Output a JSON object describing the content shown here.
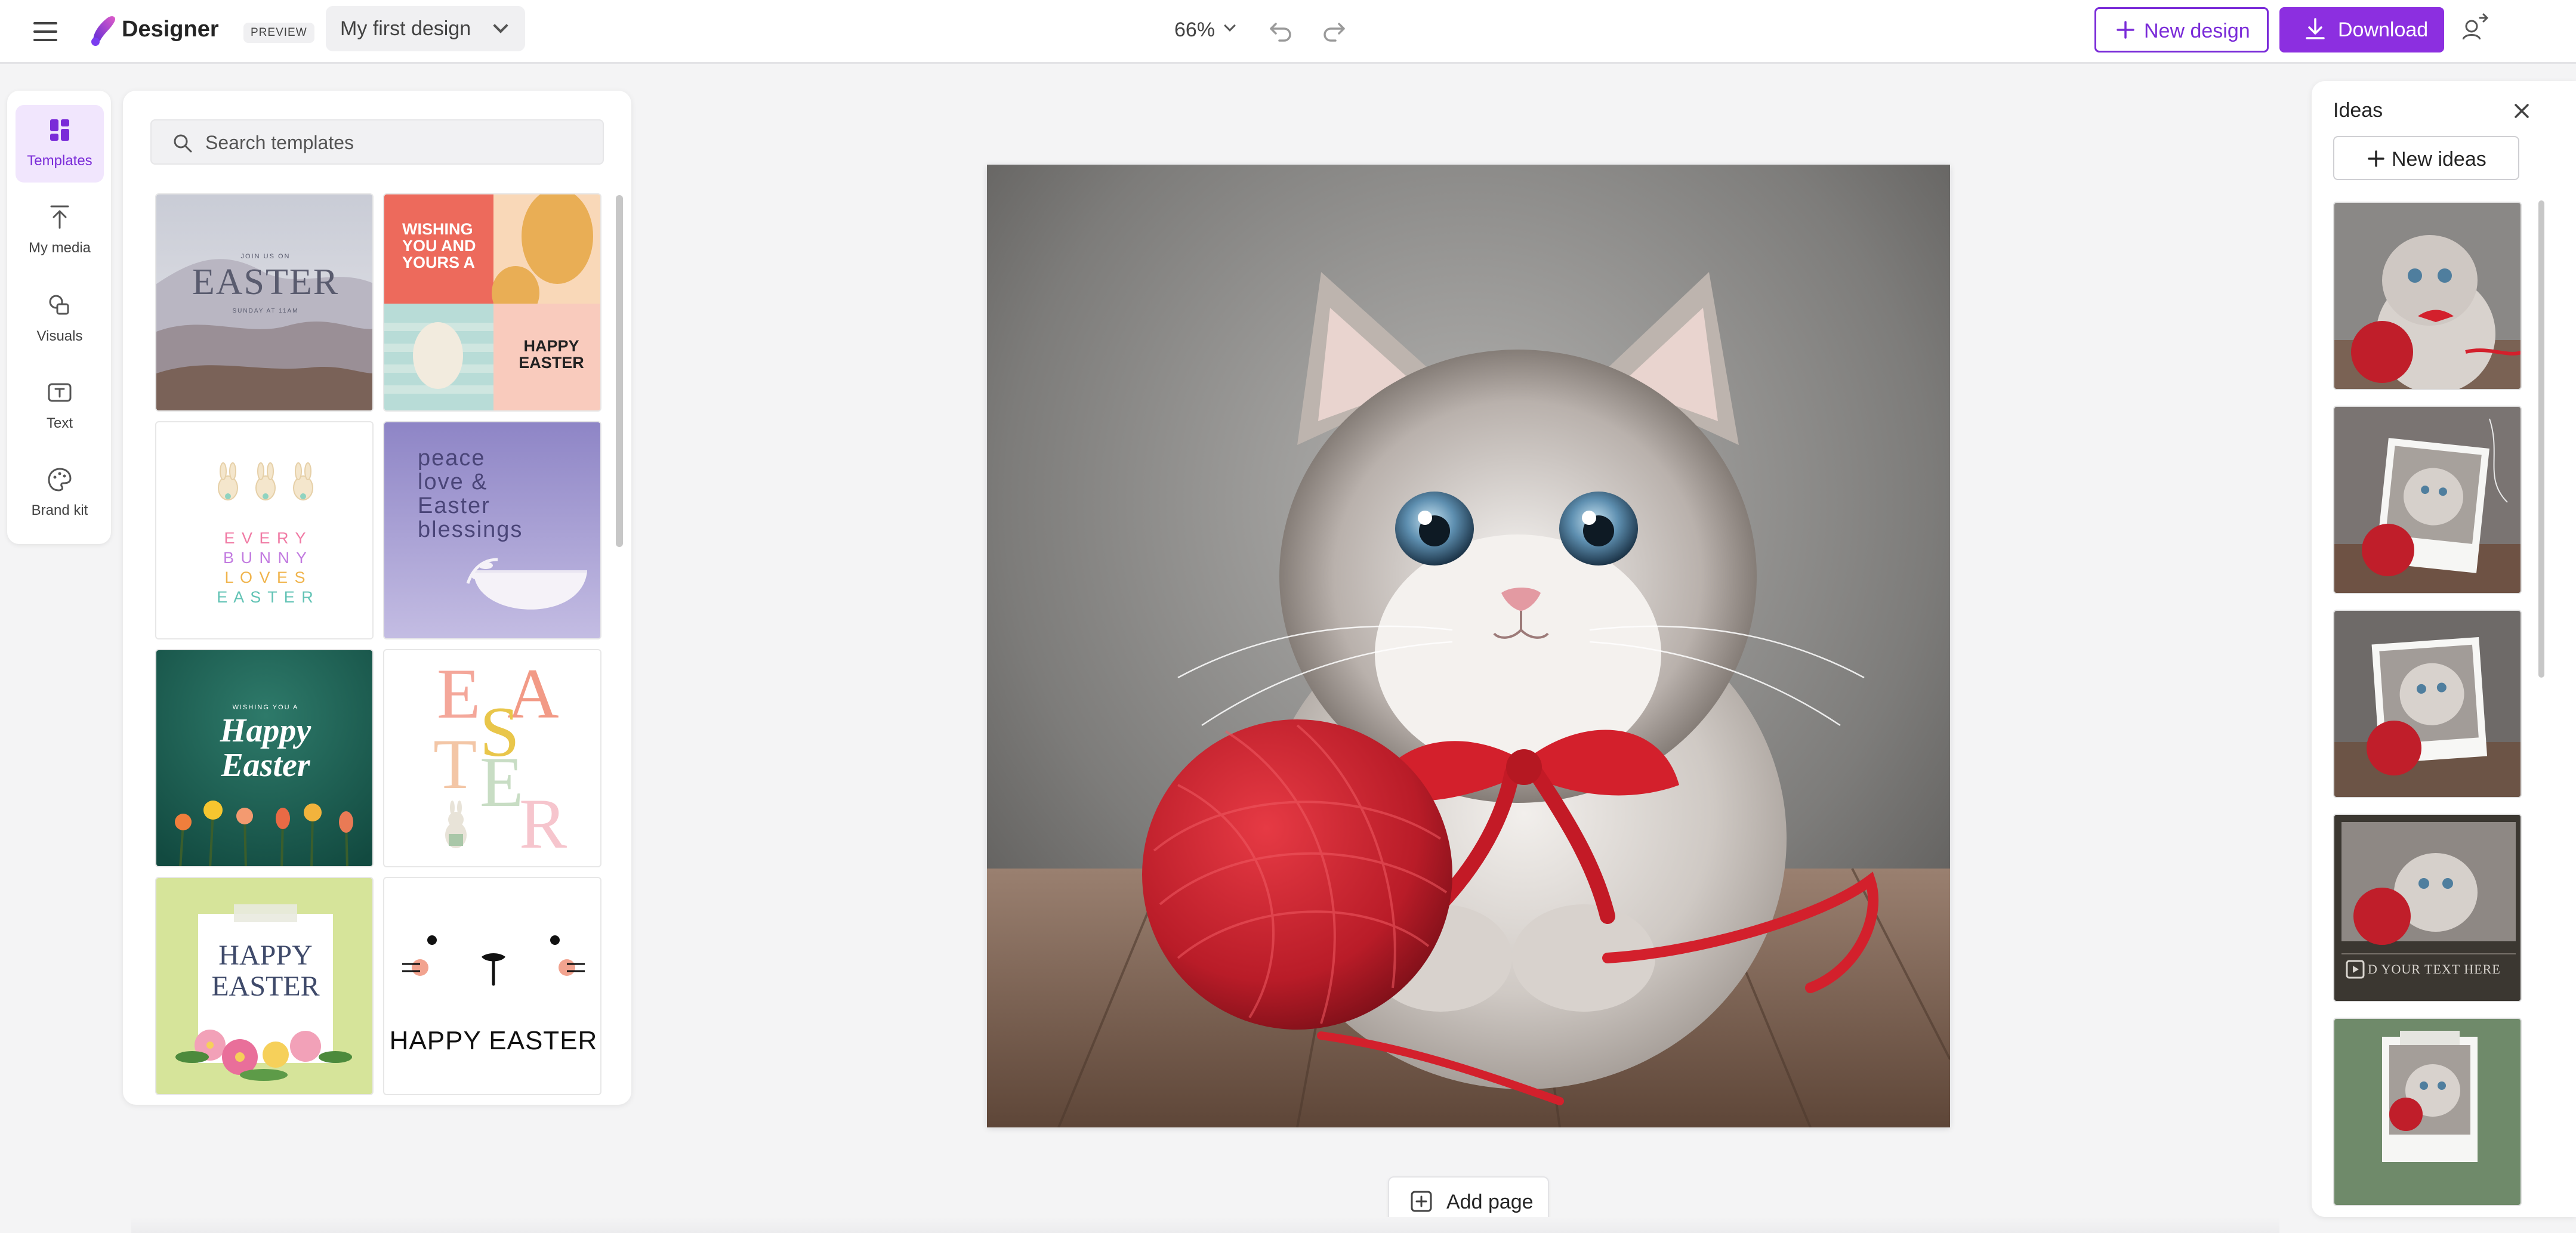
{
  "header": {
    "app_title": "Designer",
    "preview_badge": "PREVIEW",
    "design_name": "My first design",
    "zoom": "66%",
    "new_design_label": "New design",
    "download_label": "Download"
  },
  "rail": {
    "items": [
      {
        "label": "Templates",
        "icon": "templates-icon",
        "active": true
      },
      {
        "label": "My media",
        "icon": "upload-icon"
      },
      {
        "label": "Visuals",
        "icon": "visuals-icon"
      },
      {
        "label": "Text",
        "icon": "text-icon"
      },
      {
        "label": "Brand kit",
        "icon": "brand-kit-icon"
      }
    ]
  },
  "templates": {
    "search_placeholder": "Search templates",
    "cards": [
      {
        "small": "JOIN US ON",
        "title": "EASTER",
        "sub": "SUNDAY AT 11AM"
      },
      {
        "line1": "WISHING",
        "line2": "YOU AND",
        "line3": "YOURS A",
        "line4": "HAPPY",
        "line5": "EASTER"
      },
      {
        "text": "E V E R Y",
        "text2": "B U N N Y",
        "text3": "L O V E S",
        "text4": "E A S T E R"
      },
      {
        "l1": "peace",
        "l2": "love &",
        "l3": "Easter",
        "l4": "blessings"
      },
      {
        "small": "WISHING YOU A",
        "title1": "Happy",
        "title2": "Easter"
      },
      {
        "letters": [
          "E",
          "A",
          "S",
          "T",
          "E",
          "R"
        ]
      },
      {
        "l1": "HAPPY",
        "l2": "EASTER"
      },
      {
        "text": "HAPPY EASTER"
      }
    ]
  },
  "canvas": {
    "add_page_label": "Add page",
    "image_subject": "fluffy-kitten-with-red-yarn-ball"
  },
  "ideas": {
    "title": "Ideas",
    "new_ideas_label": "New ideas",
    "card4_text": "D YOUR TEXT HERE"
  },
  "colors": {
    "accent": "#8c2fe0",
    "accent_text": "#7a2bd8",
    "yarn_red": "#c8202c"
  }
}
